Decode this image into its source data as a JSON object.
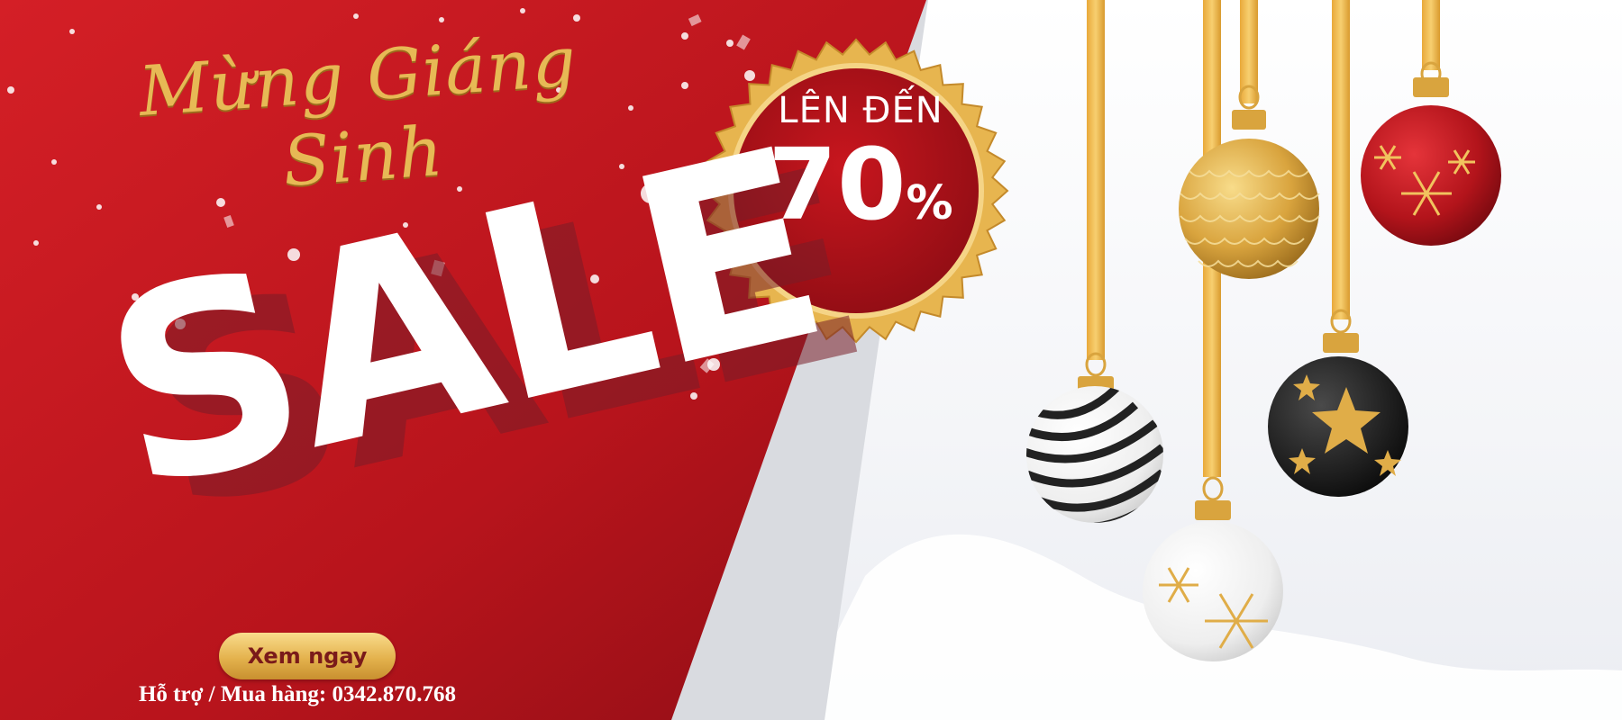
{
  "banner": {
    "greeting": "Mừng Giáng Sinh",
    "headline": "SALE",
    "badge": {
      "line1": "LÊN ĐẾN",
      "value": "70",
      "unit": "%"
    },
    "cta_label": "Xem ngay",
    "support_text": "Hỗ trợ / Mua hàng: 0342.870.768"
  },
  "colors": {
    "brand_red": "#c3161f",
    "gold": "#e3b04b",
    "background": "#f4f5f8"
  },
  "ornaments": [
    {
      "name": "gold-scale-ornament-icon"
    },
    {
      "name": "red-snowflake-ornament-icon"
    },
    {
      "name": "striped-ornament-icon"
    },
    {
      "name": "black-star-ornament-icon"
    },
    {
      "name": "white-snowflake-ornament-icon"
    }
  ]
}
